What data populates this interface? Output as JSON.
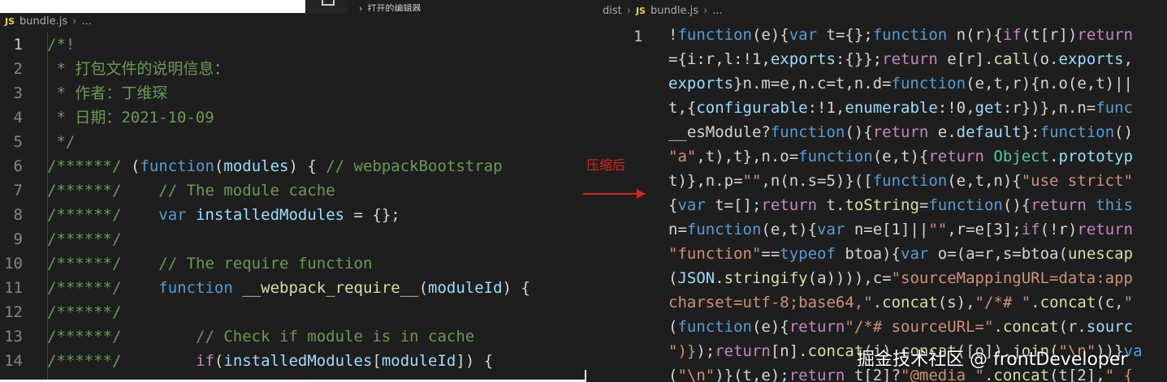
{
  "colors": {
    "comment": "#6a9955",
    "keyword": "#569cd6",
    "variable": "#9cdcfe",
    "function": "#dcdcaa",
    "string": "#ce9178",
    "control": "#c586c0",
    "text": "#d4d4d4",
    "type": "#4ec9b0",
    "annotation": "#e02020"
  },
  "mid_panel": {
    "hint": "打开的编辑器"
  },
  "left_editor": {
    "breadcrumb": {
      "icon": "js-file-icon",
      "badge": "JS",
      "file": "bundle.js",
      "more": "..."
    },
    "active_line": 1,
    "lines": [
      {
        "n": "1",
        "tokens": [
          {
            "t": "/*!",
            "c": "comment"
          }
        ]
      },
      {
        "n": "2",
        "tokens": [
          {
            "t": " * 打包文件的说明信息：",
            "c": "comment"
          }
        ]
      },
      {
        "n": "3",
        "tokens": [
          {
            "t": " * 作者：丁维琛",
            "c": "comment"
          }
        ]
      },
      {
        "n": "4",
        "tokens": [
          {
            "t": " * 日期：2021-10-09",
            "c": "comment"
          }
        ]
      },
      {
        "n": "5",
        "tokens": [
          {
            "t": " */",
            "c": "comment"
          }
        ]
      },
      {
        "n": "6",
        "tokens": [
          {
            "t": "/******/ ",
            "c": "comment"
          },
          {
            "t": "(",
            "c": "text"
          },
          {
            "t": "function",
            "c": "keyword"
          },
          {
            "t": "(",
            "c": "text"
          },
          {
            "t": "modules",
            "c": "variable"
          },
          {
            "t": ") { ",
            "c": "text"
          },
          {
            "t": "// webpackBootstrap",
            "c": "comment"
          }
        ]
      },
      {
        "n": "7",
        "tokens": [
          {
            "t": "/******/    ",
            "c": "comment"
          },
          {
            "t": "// The module cache",
            "c": "comment"
          }
        ]
      },
      {
        "n": "8",
        "tokens": [
          {
            "t": "/******/    ",
            "c": "comment"
          },
          {
            "t": "var",
            "c": "keyword"
          },
          {
            "t": " ",
            "c": "text"
          },
          {
            "t": "installedModules",
            "c": "variable"
          },
          {
            "t": " = {};",
            "c": "text"
          }
        ]
      },
      {
        "n": "9",
        "tokens": [
          {
            "t": "/******/",
            "c": "comment"
          }
        ]
      },
      {
        "n": "10",
        "tokens": [
          {
            "t": "/******/    ",
            "c": "comment"
          },
          {
            "t": "// The require function",
            "c": "comment"
          }
        ]
      },
      {
        "n": "11",
        "tokens": [
          {
            "t": "/******/    ",
            "c": "comment"
          },
          {
            "t": "function",
            "c": "keyword"
          },
          {
            "t": " ",
            "c": "text"
          },
          {
            "t": "__webpack_require__",
            "c": "function"
          },
          {
            "t": "(",
            "c": "text"
          },
          {
            "t": "moduleId",
            "c": "variable"
          },
          {
            "t": ") {",
            "c": "text"
          }
        ]
      },
      {
        "n": "12",
        "tokens": [
          {
            "t": "/******/",
            "c": "comment"
          }
        ]
      },
      {
        "n": "13",
        "tokens": [
          {
            "t": "/******/        ",
            "c": "comment"
          },
          {
            "t": "// Check if module is in cache",
            "c": "comment"
          }
        ]
      },
      {
        "n": "14",
        "tokens": [
          {
            "t": "/******/        ",
            "c": "comment"
          },
          {
            "t": "if",
            "c": "control"
          },
          {
            "t": "(",
            "c": "text"
          },
          {
            "t": "installedModules",
            "c": "variable"
          },
          {
            "t": "[",
            "c": "text"
          },
          {
            "t": "moduleId",
            "c": "variable"
          },
          {
            "t": "]) {",
            "c": "text"
          }
        ]
      }
    ]
  },
  "annotation": {
    "label": "压缩后"
  },
  "right_editor": {
    "breadcrumb": {
      "folder": "dist",
      "icon": "js-file-icon",
      "badge": "JS",
      "file": "bundle.js",
      "more": "..."
    },
    "line_number": "1",
    "lines": [
      [
        {
          "t": "!",
          "c": "text"
        },
        {
          "t": "function",
          "c": "keyword"
        },
        {
          "t": "(e){",
          "c": "text"
        },
        {
          "t": "var",
          "c": "keyword"
        },
        {
          "t": " t={};",
          "c": "text"
        },
        {
          "t": "function",
          "c": "keyword"
        },
        {
          "t": " n(r){",
          "c": "text"
        },
        {
          "t": "if",
          "c": "control"
        },
        {
          "t": "(t[r])",
          "c": "text"
        },
        {
          "t": "return",
          "c": "control"
        }
      ],
      [
        {
          "t": "={i:r,l:!1,",
          "c": "text"
        },
        {
          "t": "exports",
          "c": "variable"
        },
        {
          "t": ":{}};",
          "c": "text"
        },
        {
          "t": "return",
          "c": "control"
        },
        {
          "t": " e[r].",
          "c": "text"
        },
        {
          "t": "call",
          "c": "function"
        },
        {
          "t": "(o.",
          "c": "text"
        },
        {
          "t": "exports",
          "c": "variable"
        },
        {
          "t": ",",
          "c": "text"
        }
      ],
      [
        {
          "t": "exports",
          "c": "variable"
        },
        {
          "t": "}n.m=e,n.c=t,n.d=",
          "c": "text"
        },
        {
          "t": "function",
          "c": "keyword"
        },
        {
          "t": "(e,t,r){n.o(e,t)||",
          "c": "text"
        }
      ],
      [
        {
          "t": "t,{",
          "c": "text"
        },
        {
          "t": "configurable",
          "c": "variable"
        },
        {
          "t": ":!1,",
          "c": "text"
        },
        {
          "t": "enumerable",
          "c": "variable"
        },
        {
          "t": ":!0,",
          "c": "text"
        },
        {
          "t": "get",
          "c": "variable"
        },
        {
          "t": ":r})},n.n=",
          "c": "text"
        },
        {
          "t": "func",
          "c": "keyword"
        }
      ],
      [
        {
          "t": "__esModule?",
          "c": "text"
        },
        {
          "t": "function",
          "c": "keyword"
        },
        {
          "t": "(){",
          "c": "text"
        },
        {
          "t": "return",
          "c": "control"
        },
        {
          "t": " e.",
          "c": "text"
        },
        {
          "t": "default",
          "c": "variable"
        },
        {
          "t": "}:",
          "c": "text"
        },
        {
          "t": "function",
          "c": "keyword"
        },
        {
          "t": "()",
          "c": "text"
        }
      ],
      [
        {
          "t": "\"a\"",
          "c": "string"
        },
        {
          "t": ",t),t},n.o=",
          "c": "text"
        },
        {
          "t": "function",
          "c": "keyword"
        },
        {
          "t": "(e,t){",
          "c": "text"
        },
        {
          "t": "return",
          "c": "control"
        },
        {
          "t": " ",
          "c": "text"
        },
        {
          "t": "Object",
          "c": "type"
        },
        {
          "t": ".",
          "c": "text"
        },
        {
          "t": "prototyp",
          "c": "variable"
        }
      ],
      [
        {
          "t": "t)},n.p=",
          "c": "text"
        },
        {
          "t": "\"\"",
          "c": "string"
        },
        {
          "t": ",n(n.s=5)}([",
          "c": "text"
        },
        {
          "t": "function",
          "c": "keyword"
        },
        {
          "t": "(e,t,n){",
          "c": "text"
        },
        {
          "t": "\"use strict\"",
          "c": "string"
        }
      ],
      [
        {
          "t": "{",
          "c": "text"
        },
        {
          "t": "var",
          "c": "keyword"
        },
        {
          "t": " t=[];",
          "c": "text"
        },
        {
          "t": "return",
          "c": "control"
        },
        {
          "t": " t.",
          "c": "text"
        },
        {
          "t": "toString",
          "c": "function"
        },
        {
          "t": "=",
          "c": "text"
        },
        {
          "t": "function",
          "c": "keyword"
        },
        {
          "t": "(){",
          "c": "text"
        },
        {
          "t": "return",
          "c": "control"
        },
        {
          "t": " ",
          "c": "text"
        },
        {
          "t": "this",
          "c": "keyword"
        }
      ],
      [
        {
          "t": "n=",
          "c": "text"
        },
        {
          "t": "function",
          "c": "keyword"
        },
        {
          "t": "(e,t){",
          "c": "text"
        },
        {
          "t": "var",
          "c": "keyword"
        },
        {
          "t": " n=e[1]||",
          "c": "text"
        },
        {
          "t": "\"\"",
          "c": "string"
        },
        {
          "t": ",r=e[3];",
          "c": "text"
        },
        {
          "t": "if",
          "c": "control"
        },
        {
          "t": "(!r)",
          "c": "text"
        },
        {
          "t": "return",
          "c": "control"
        }
      ],
      [
        {
          "t": "\"function\"",
          "c": "string"
        },
        {
          "t": "==",
          "c": "text"
        },
        {
          "t": "typeof",
          "c": "keyword"
        },
        {
          "t": " btoa){",
          "c": "text"
        },
        {
          "t": "var",
          "c": "keyword"
        },
        {
          "t": " o=(a=r,s=",
          "c": "text"
        },
        {
          "t": "btoa",
          "c": "text"
        },
        {
          "t": "(",
          "c": "text"
        },
        {
          "t": "unescap",
          "c": "function"
        }
      ],
      [
        {
          "t": "(",
          "c": "text"
        },
        {
          "t": "JSON",
          "c": "variable"
        },
        {
          "t": ".",
          "c": "text"
        },
        {
          "t": "stringify",
          "c": "function"
        },
        {
          "t": "(a)))),c=",
          "c": "text"
        },
        {
          "t": "\"sourceMappingURL=data:app",
          "c": "string"
        }
      ],
      [
        {
          "t": "charset=utf-8;base64,\"",
          "c": "string"
        },
        {
          "t": ".",
          "c": "text"
        },
        {
          "t": "concat",
          "c": "function"
        },
        {
          "t": "(s),",
          "c": "text"
        },
        {
          "t": "\"/*# \"",
          "c": "string"
        },
        {
          "t": ".",
          "c": "text"
        },
        {
          "t": "concat",
          "c": "function"
        },
        {
          "t": "(c,",
          "c": "text"
        },
        {
          "t": "\"",
          "c": "string"
        }
      ],
      [
        {
          "t": "(",
          "c": "text"
        },
        {
          "t": "function",
          "c": "keyword"
        },
        {
          "t": "(e){",
          "c": "text"
        },
        {
          "t": "return",
          "c": "control"
        },
        {
          "t": "\"/*# sourceURL=\"",
          "c": "string"
        },
        {
          "t": ".",
          "c": "text"
        },
        {
          "t": "concat",
          "c": "function"
        },
        {
          "t": "(r.",
          "c": "text"
        },
        {
          "t": "sourc",
          "c": "variable"
        }
      ],
      [
        {
          "t": "\")}",
          "c": "string"
        },
        {
          "t": ");",
          "c": "text"
        },
        {
          "t": "return",
          "c": "control"
        },
        {
          "t": "[n].",
          "c": "text"
        },
        {
          "t": "concat",
          "c": "function"
        },
        {
          "t": "(i).",
          "c": "text"
        },
        {
          "t": "concat",
          "c": "function"
        },
        {
          "t": "([o]).",
          "c": "text"
        },
        {
          "t": "join",
          "c": "function"
        },
        {
          "t": "(",
          "c": "text"
        },
        {
          "t": "\"\\n\"",
          "c": "string"
        },
        {
          "t": "))}",
          "c": "text"
        },
        {
          "t": "va",
          "c": "keyword"
        }
      ],
      [
        {
          "t": "(",
          "c": "text"
        },
        {
          "t": "\"\\n\"",
          "c": "string"
        },
        {
          "t": ")}(t,e);",
          "c": "text"
        },
        {
          "t": "return",
          "c": "control"
        },
        {
          "t": " t[2]?",
          "c": "text"
        },
        {
          "t": "\"@media \"",
          "c": "string"
        },
        {
          "t": ".",
          "c": "text"
        },
        {
          "t": "concat",
          "c": "function"
        },
        {
          "t": "(t[2],",
          "c": "text"
        },
        {
          "t": "\" {",
          "c": "string"
        }
      ]
    ]
  },
  "watermark": {
    "text": "掘金技术社区 @ frontDeveloper"
  }
}
